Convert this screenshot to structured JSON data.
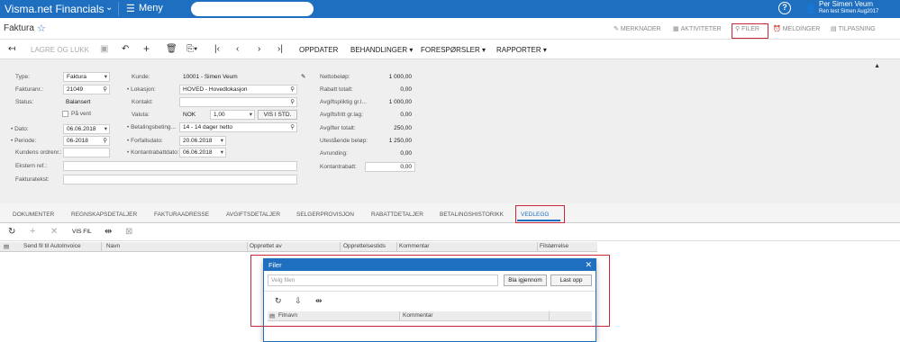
{
  "topbar": {
    "brand": "Visma.net Financials",
    "menu_label": "Meny",
    "user_name": "Per Simen Veum",
    "user_company": "Ren test Simen Aug2017",
    "help": "?"
  },
  "title": "Faktura",
  "top_actions": {
    "merknader": "MERKNADER",
    "aktiviteter": "AKTIVITETER",
    "filer": "FILER",
    "meldinger": "MELDINGER",
    "tilpasning": "TILPASNING"
  },
  "toolbar": {
    "lagre_og_lukk": "LAGRE OG LUKK",
    "oppdater": "OPPDATER",
    "behandlinger": "BEHANDLINGER",
    "forespoersler": "FORESPØRSLER",
    "rapporter": "RAPPORTER"
  },
  "form": {
    "type_label": "Type:",
    "type_value": "Faktura",
    "fakturanr_label": "Fakturanr.:",
    "fakturanr_value": "21049",
    "status_label": "Status:",
    "status_value": "Balansert",
    "paa_vent_label": "På vent",
    "dato_label": "Dato:",
    "dato_value": "06.06.2018",
    "periode_label": "Periode:",
    "periode_value": "06-2018",
    "kundens_ordrenr_label": "Kundens ordrenr.:",
    "kundens_ordrenr_value": "",
    "ekstern_ref_label": "Ekstern ref.:",
    "fakturatekst_label": "Fakturatekst:",
    "kunde_label": "Kunde:",
    "kunde_value": "10001 - Simen Veum",
    "lokasjon_label": "Lokasjon:",
    "lokasjon_value": "HOVED - Hovedlokasjon",
    "kontakt_label": "Kontakt:",
    "kontakt_value": "",
    "valuta_label": "Valuta:",
    "valuta_value": "NOK",
    "valuta_rate": "1,00",
    "vis_i_std": "VIS I STD.",
    "betalingsbet_label": "Betalingsbeting...",
    "betalingsbet_value": "14 - 14 dager netto",
    "forfallsdato_label": "Forfallsdato:",
    "forfallsdato_value": "20.06.2018",
    "kontantrabattdato_label": "Kontantrabattdato:",
    "kontantrabattdato_value": "06.06.2018",
    "nettobelop_label": "Nettobeløp:",
    "nettobelop_value": "1 000,00",
    "rabatt_totalt_label": "Rabatt totalt:",
    "rabatt_totalt_value": "0,00",
    "avgiftspliktig_label": "Avgiftspliktig gr.l...",
    "avgiftspliktig_value": "1 000,00",
    "avgiftsfritt_label": "Avgiftsfritt gr.lag:",
    "avgiftsfritt_value": "0,00",
    "avgifter_totalt_label": "Avgifter totalt:",
    "avgifter_totalt_value": "250,00",
    "utestaaende_label": "Utestående beløp:",
    "utestaaende_value": "1 250,00",
    "avrunding_label": "Avrunding:",
    "avrunding_value": "0,00",
    "kontantrabatt_label": "Kontantrabatt:",
    "kontantrabatt_value": "0,00"
  },
  "tabs": [
    "DOKUMENTER",
    "REGNSKAPSDETALJER",
    "FAKTURAADRESSE",
    "AVGIFTSDETALJER",
    "SELGERPROVISJON",
    "RABATTDETALJER",
    "BETALINGSHISTORIKK",
    "VEDLEGG"
  ],
  "grid": {
    "vis_fil": "VIS FIL",
    "columns": [
      "Send fil til AutoInvoice",
      "Navn",
      "Opprettet av",
      "Opprettelsestids",
      "Kommentar",
      "Filstørrelse"
    ]
  },
  "dialog": {
    "title": "Filer",
    "file_placeholder": "Velg filen",
    "browse_button": "Bla igjennom",
    "upload_button": "Last opp",
    "columns": [
      "Filnavn",
      "Kommentar"
    ]
  },
  "colors": {
    "brand_blue": "#1e6fbf",
    "highlight_red": "#c8283b"
  }
}
